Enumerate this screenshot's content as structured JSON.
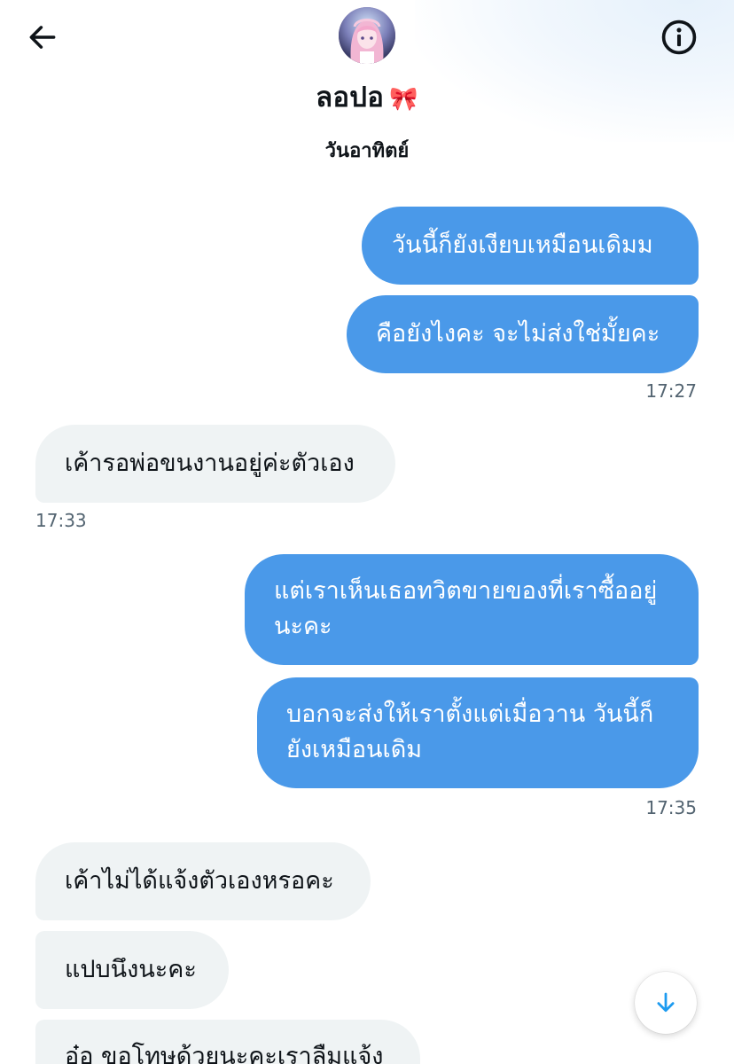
{
  "header": {
    "contact_name": "ลอปอ",
    "name_badge": "🎀",
    "back_icon": "arrow-left-icon",
    "info_icon": "info-circle-icon"
  },
  "date_separator": "วันอาทิตย์",
  "messages": [
    {
      "side": "sent",
      "text": "วันนี้ก็ยังเงียบเหมือนเดิมม"
    },
    {
      "side": "sent",
      "text": "คือยังไงคะ จะไม่ส่งใช่มั้ยคะ"
    },
    {
      "side": "recv",
      "text": "เค้ารอพ่อขนงานอยู่ค่ะตัวเอง"
    },
    {
      "side": "sent",
      "lines": [
        "แต่เราเห็นเธอทวิตขายของที่เราซื้ออยู่",
        "นะคะ"
      ]
    },
    {
      "side": "sent",
      "lines": [
        "บอกจะส่งให้เราตั้งแต่เมื่อวาน วันนี้ก็",
        "ยังเหมือนเดิม"
      ]
    },
    {
      "side": "recv",
      "text": "เค้าไม่ได้แจ้งตัวเองหรอคะ"
    },
    {
      "side": "recv",
      "text": "แปบนึงนะคะ"
    },
    {
      "side": "recv",
      "text": "อ๋อ ขอโทษด้วยนะคะเราลืมแจ้ง"
    }
  ],
  "timestamps": [
    "17:27",
    "17:33",
    "17:35"
  ],
  "scroll_button_icon": "arrow-down-icon",
  "colors": {
    "sent_bubble": "#4a99e9",
    "received_bubble": "#eff3f4",
    "accent": "#1d9bf0"
  }
}
